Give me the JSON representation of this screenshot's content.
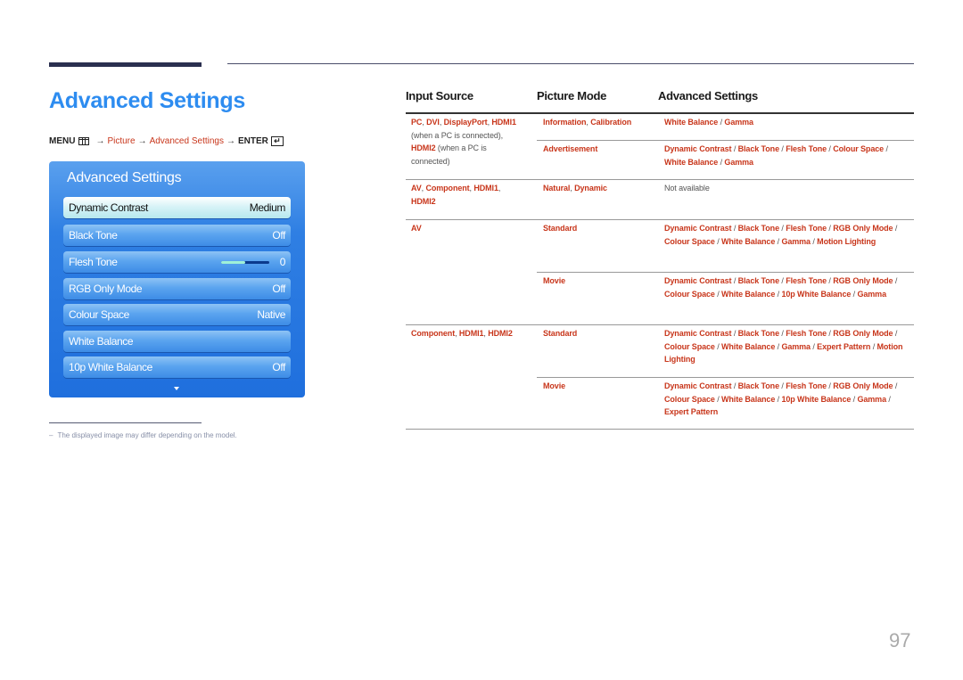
{
  "page": {
    "title": "Advanced Settings",
    "page_number": "97"
  },
  "breadcrumb": {
    "menu": "MENU",
    "arrow": "→",
    "picture": "Picture",
    "advanced": "Advanced Settings",
    "enter": "ENTER",
    "enter_glyph": "↵"
  },
  "osd": {
    "title": "Advanced Settings",
    "items": [
      {
        "label": "Dynamic Contrast",
        "value": "Medium",
        "selected": true
      },
      {
        "label": "Black Tone",
        "value": "Off"
      },
      {
        "label": "Flesh Tone",
        "value": "0",
        "slider_fraction": 0.5
      },
      {
        "label": "RGB Only Mode",
        "value": "Off"
      },
      {
        "label": "Colour Space",
        "value": "Native"
      },
      {
        "label": "White Balance",
        "value": ""
      },
      {
        "label": "10p White Balance",
        "value": "Off"
      }
    ],
    "scroll_icon": "down-arrow-icon"
  },
  "note": {
    "dash": "–",
    "text": "The displayed image may differ depending on the model."
  },
  "table": {
    "headers": [
      "Input Source",
      "Picture Mode",
      "Advanced Settings"
    ],
    "rows": [
      {
        "source_parts": [
          "PC",
          "DVI",
          "DisplayPort",
          "HDMI1"
        ],
        "source_note1": "(when a PC is connected),",
        "source_part2": "HDMI2",
        "source_note2": "(when a PC is",
        "source_note3": "connected)",
        "modes": [
          {
            "mode": "Information, Calibration",
            "settings": "White Balance / Gamma"
          },
          {
            "mode": "Advertisement",
            "settings": "Dynamic Contrast / Black Tone / Flesh Tone / Colour Space / White Balance / Gamma"
          }
        ]
      },
      {
        "source": "AV, Component, HDMI1, HDMI2",
        "modes": [
          {
            "mode": "Natural, Dynamic",
            "settings": "Not available"
          }
        ]
      },
      {
        "source": "AV",
        "modes": [
          {
            "mode": "Standard",
            "settings": "Dynamic Contrast / Black Tone / Flesh Tone / RGB Only Mode / Colour Space / White Balance / Gamma / Motion Lighting"
          },
          {
            "mode": "Movie",
            "settings": "Dynamic Contrast / Black Tone / Flesh Tone / RGB Only Mode / Colour Space / White Balance / 10p White Balance / Gamma"
          }
        ]
      },
      {
        "source": "Component, HDMI1, HDMI2",
        "modes": [
          {
            "mode": "Standard",
            "settings": "Dynamic Contrast / Black Tone / Flesh Tone / RGB Only Mode / Colour Space / White Balance / Gamma / Expert Pattern / Motion Lighting"
          },
          {
            "mode": "Movie",
            "settings": "Dynamic Contrast / Black Tone / Flesh Tone / RGB Only Mode / Colour Space / White Balance / 10p White Balance / Gamma / Expert Pattern"
          }
        ]
      }
    ]
  },
  "colors": {
    "title_blue": "#2d8cf0",
    "link_red": "#c8361b",
    "osd_blue": "#1f6fdd"
  }
}
